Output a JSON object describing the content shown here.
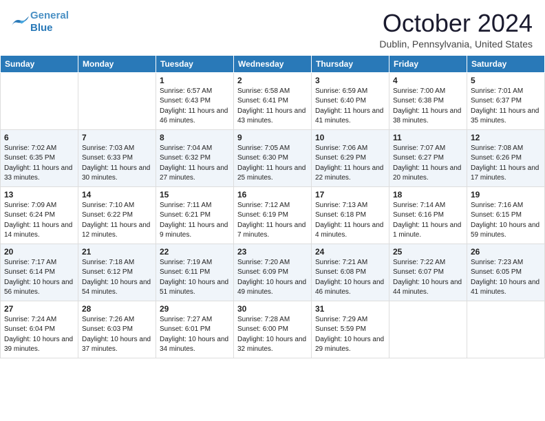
{
  "header": {
    "logo": {
      "general": "General",
      "blue": "Blue"
    },
    "title": "October 2024",
    "location": "Dublin, Pennsylvania, United States"
  },
  "weekdays": [
    "Sunday",
    "Monday",
    "Tuesday",
    "Wednesday",
    "Thursday",
    "Friday",
    "Saturday"
  ],
  "weeks": [
    [
      {
        "day": "",
        "sunrise": "",
        "sunset": "",
        "daylight": ""
      },
      {
        "day": "",
        "sunrise": "",
        "sunset": "",
        "daylight": ""
      },
      {
        "day": "1",
        "sunrise": "Sunrise: 6:57 AM",
        "sunset": "Sunset: 6:43 PM",
        "daylight": "Daylight: 11 hours and 46 minutes."
      },
      {
        "day": "2",
        "sunrise": "Sunrise: 6:58 AM",
        "sunset": "Sunset: 6:41 PM",
        "daylight": "Daylight: 11 hours and 43 minutes."
      },
      {
        "day": "3",
        "sunrise": "Sunrise: 6:59 AM",
        "sunset": "Sunset: 6:40 PM",
        "daylight": "Daylight: 11 hours and 41 minutes."
      },
      {
        "day": "4",
        "sunrise": "Sunrise: 7:00 AM",
        "sunset": "Sunset: 6:38 PM",
        "daylight": "Daylight: 11 hours and 38 minutes."
      },
      {
        "day": "5",
        "sunrise": "Sunrise: 7:01 AM",
        "sunset": "Sunset: 6:37 PM",
        "daylight": "Daylight: 11 hours and 35 minutes."
      }
    ],
    [
      {
        "day": "6",
        "sunrise": "Sunrise: 7:02 AM",
        "sunset": "Sunset: 6:35 PM",
        "daylight": "Daylight: 11 hours and 33 minutes."
      },
      {
        "day": "7",
        "sunrise": "Sunrise: 7:03 AM",
        "sunset": "Sunset: 6:33 PM",
        "daylight": "Daylight: 11 hours and 30 minutes."
      },
      {
        "day": "8",
        "sunrise": "Sunrise: 7:04 AM",
        "sunset": "Sunset: 6:32 PM",
        "daylight": "Daylight: 11 hours and 27 minutes."
      },
      {
        "day": "9",
        "sunrise": "Sunrise: 7:05 AM",
        "sunset": "Sunset: 6:30 PM",
        "daylight": "Daylight: 11 hours and 25 minutes."
      },
      {
        "day": "10",
        "sunrise": "Sunrise: 7:06 AM",
        "sunset": "Sunset: 6:29 PM",
        "daylight": "Daylight: 11 hours and 22 minutes."
      },
      {
        "day": "11",
        "sunrise": "Sunrise: 7:07 AM",
        "sunset": "Sunset: 6:27 PM",
        "daylight": "Daylight: 11 hours and 20 minutes."
      },
      {
        "day": "12",
        "sunrise": "Sunrise: 7:08 AM",
        "sunset": "Sunset: 6:26 PM",
        "daylight": "Daylight: 11 hours and 17 minutes."
      }
    ],
    [
      {
        "day": "13",
        "sunrise": "Sunrise: 7:09 AM",
        "sunset": "Sunset: 6:24 PM",
        "daylight": "Daylight: 11 hours and 14 minutes."
      },
      {
        "day": "14",
        "sunrise": "Sunrise: 7:10 AM",
        "sunset": "Sunset: 6:22 PM",
        "daylight": "Daylight: 11 hours and 12 minutes."
      },
      {
        "day": "15",
        "sunrise": "Sunrise: 7:11 AM",
        "sunset": "Sunset: 6:21 PM",
        "daylight": "Daylight: 11 hours and 9 minutes."
      },
      {
        "day": "16",
        "sunrise": "Sunrise: 7:12 AM",
        "sunset": "Sunset: 6:19 PM",
        "daylight": "Daylight: 11 hours and 7 minutes."
      },
      {
        "day": "17",
        "sunrise": "Sunrise: 7:13 AM",
        "sunset": "Sunset: 6:18 PM",
        "daylight": "Daylight: 11 hours and 4 minutes."
      },
      {
        "day": "18",
        "sunrise": "Sunrise: 7:14 AM",
        "sunset": "Sunset: 6:16 PM",
        "daylight": "Daylight: 11 hours and 1 minute."
      },
      {
        "day": "19",
        "sunrise": "Sunrise: 7:16 AM",
        "sunset": "Sunset: 6:15 PM",
        "daylight": "Daylight: 10 hours and 59 minutes."
      }
    ],
    [
      {
        "day": "20",
        "sunrise": "Sunrise: 7:17 AM",
        "sunset": "Sunset: 6:14 PM",
        "daylight": "Daylight: 10 hours and 56 minutes."
      },
      {
        "day": "21",
        "sunrise": "Sunrise: 7:18 AM",
        "sunset": "Sunset: 6:12 PM",
        "daylight": "Daylight: 10 hours and 54 minutes."
      },
      {
        "day": "22",
        "sunrise": "Sunrise: 7:19 AM",
        "sunset": "Sunset: 6:11 PM",
        "daylight": "Daylight: 10 hours and 51 minutes."
      },
      {
        "day": "23",
        "sunrise": "Sunrise: 7:20 AM",
        "sunset": "Sunset: 6:09 PM",
        "daylight": "Daylight: 10 hours and 49 minutes."
      },
      {
        "day": "24",
        "sunrise": "Sunrise: 7:21 AM",
        "sunset": "Sunset: 6:08 PM",
        "daylight": "Daylight: 10 hours and 46 minutes."
      },
      {
        "day": "25",
        "sunrise": "Sunrise: 7:22 AM",
        "sunset": "Sunset: 6:07 PM",
        "daylight": "Daylight: 10 hours and 44 minutes."
      },
      {
        "day": "26",
        "sunrise": "Sunrise: 7:23 AM",
        "sunset": "Sunset: 6:05 PM",
        "daylight": "Daylight: 10 hours and 41 minutes."
      }
    ],
    [
      {
        "day": "27",
        "sunrise": "Sunrise: 7:24 AM",
        "sunset": "Sunset: 6:04 PM",
        "daylight": "Daylight: 10 hours and 39 minutes."
      },
      {
        "day": "28",
        "sunrise": "Sunrise: 7:26 AM",
        "sunset": "Sunset: 6:03 PM",
        "daylight": "Daylight: 10 hours and 37 minutes."
      },
      {
        "day": "29",
        "sunrise": "Sunrise: 7:27 AM",
        "sunset": "Sunset: 6:01 PM",
        "daylight": "Daylight: 10 hours and 34 minutes."
      },
      {
        "day": "30",
        "sunrise": "Sunrise: 7:28 AM",
        "sunset": "Sunset: 6:00 PM",
        "daylight": "Daylight: 10 hours and 32 minutes."
      },
      {
        "day": "31",
        "sunrise": "Sunrise: 7:29 AM",
        "sunset": "Sunset: 5:59 PM",
        "daylight": "Daylight: 10 hours and 29 minutes."
      },
      {
        "day": "",
        "sunrise": "",
        "sunset": "",
        "daylight": ""
      },
      {
        "day": "",
        "sunrise": "",
        "sunset": "",
        "daylight": ""
      }
    ]
  ]
}
